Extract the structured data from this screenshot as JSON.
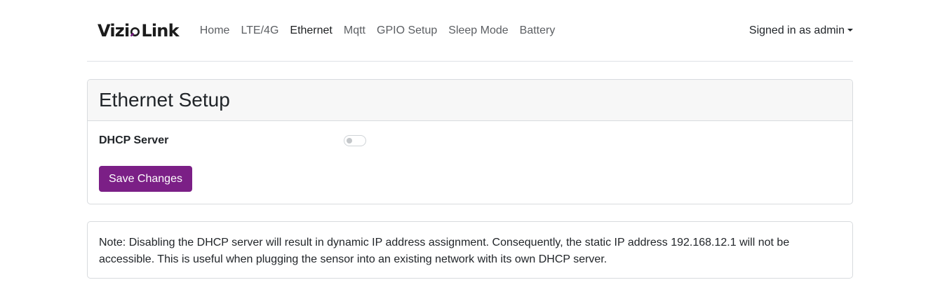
{
  "brand": {
    "name_part1": "Vizi",
    "name_part2": "Link",
    "accent_color": "#7b1f86"
  },
  "nav": {
    "items": [
      {
        "label": "Home",
        "active": false
      },
      {
        "label": "LTE/4G",
        "active": false
      },
      {
        "label": "Ethernet",
        "active": true
      },
      {
        "label": "Mqtt",
        "active": false
      },
      {
        "label": "GPIO Setup",
        "active": false
      },
      {
        "label": "Sleep Mode",
        "active": false
      },
      {
        "label": "Battery",
        "active": false
      }
    ],
    "user_label": "Signed in as admin",
    "user_icon": "caret-down-icon"
  },
  "card": {
    "title": "Ethernet Setup",
    "dhcp_label": "DHCP Server",
    "dhcp_enabled": false,
    "save_label": "Save Changes",
    "save_color": "#7b1f86"
  },
  "note": {
    "text": "Note: Disabling the DHCP server will result in dynamic IP address assignment. Consequently, the static IP address 192.168.12.1 will not be accessible. This is useful when plugging the sensor into an existing network with its own DHCP server."
  }
}
